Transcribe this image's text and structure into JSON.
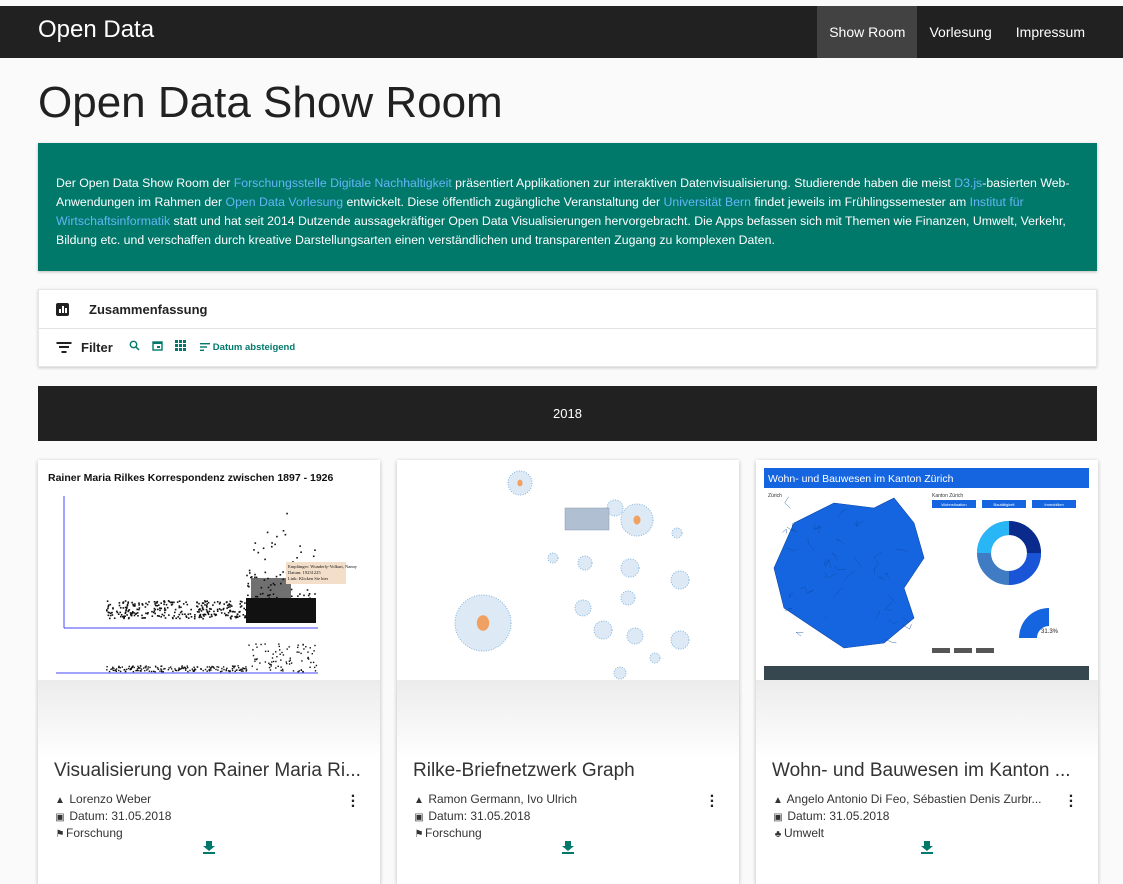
{
  "header": {
    "brand": "Open Data",
    "nav": [
      "Show Room",
      "Vorlesung",
      "Impressum"
    ]
  },
  "page": {
    "title": "Open Data Show Room",
    "intro": {
      "t1": "Der Open Data Show Room der ",
      "l1": "Forschungsstelle Digitale Nachhaltigkeit",
      "t2": " präsentiert Applikationen zur interaktiven Datenvisualisierung. Studierende haben die meist ",
      "l2": "D3.js",
      "t3": "-basierten Web-Anwendungen im Rahmen der ",
      "l3": "Open Data Vorlesung",
      "t4": " entwickelt. Diese öffentlich zugängliche Veranstaltung der ",
      "l4": "Universität Bern",
      "t5": " findet jeweils im Frühlingssemester am ",
      "l5": "Institut für Wirtschaftsinformatik",
      "t6": " statt und hat seit 2014 Dutzende aussagekräftiger Open Data Visualisierungen hervorgebracht. Die Apps befassen sich mit Themen wie Finanzen, Umwelt, Verkehr, Bildung etc. und verschaffen durch kreative Darstellungsarten einen verständlichen und transparenten Zugang zu komplexen Daten."
    }
  },
  "panel": {
    "summary_label": "Zusammenfassung",
    "filter_label": "Filter",
    "sort_label": "Datum absteigend"
  },
  "year": "2018",
  "cards": [
    {
      "title": "Visualisierung von Rainer Maria Ri...",
      "author": "Lorenzo Weber",
      "date": "Datum: 31.05.2018",
      "category": "Forschung",
      "thumb_title": "Rainer Maria Rilkes Korrespondenz zwischen 1897 - 1926",
      "tooltip": [
        "Empfänger: Wunderly-Volkart, Nanny",
        "Datum: 19231225",
        "Link: Klicken Sie hier"
      ]
    },
    {
      "title": "Rilke-Briefnetzwerk Graph",
      "author": "Ramon Germann, Ivo Ulrich",
      "date": "Datum: 31.05.2018",
      "category": "Forschung"
    },
    {
      "title": "Wohn- und Bauwesen im Kanton ...",
      "author": "Angelo Antonio Di Feo, Sébastien Denis Zurbr...",
      "date": "Datum: 31.05.2018",
      "category": "Umwelt",
      "thumb_title": "Wohn- und Bauwesen im Kanton Zürich",
      "thumb_map_label": "Zürich",
      "thumb_side_title": "Kanton Zürich",
      "thumb_buttons": [
        "Wohnsituation",
        "Bautätigkeit",
        "Immobilien"
      ],
      "thumb_percent": "31.3%"
    }
  ],
  "colors": {
    "topbar": "#212121",
    "accent": "#00796b",
    "link": "#64b5f6",
    "map_blue": "#1565e0"
  }
}
